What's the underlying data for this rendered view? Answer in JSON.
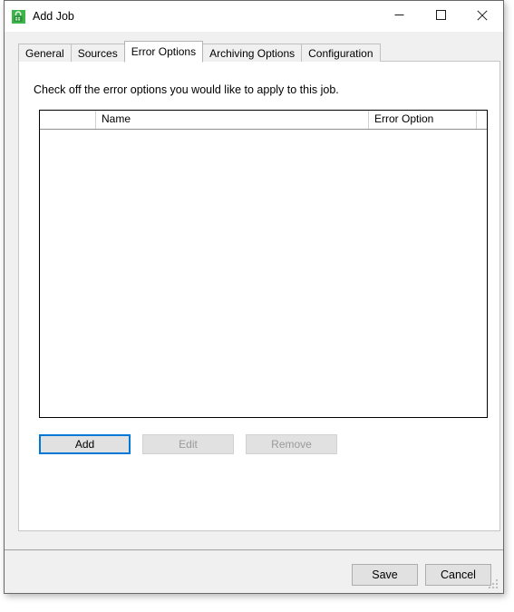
{
  "window": {
    "title": "Add Job",
    "icon": "green-lock-app-icon",
    "controls": {
      "minimize": "minimize-icon",
      "maximize": "maximize-icon",
      "close": "close-icon"
    }
  },
  "tabs": [
    {
      "label": "General",
      "selected": false
    },
    {
      "label": "Sources",
      "selected": false
    },
    {
      "label": "Error Options",
      "selected": true
    },
    {
      "label": "Archiving Options",
      "selected": false
    },
    {
      "label": "Configuration",
      "selected": false
    }
  ],
  "panel": {
    "instruction": "Check off the error options you would like to apply to this job."
  },
  "grid": {
    "columns": [
      {
        "key": "check",
        "label": ""
      },
      {
        "key": "name",
        "label": "Name"
      },
      {
        "key": "error",
        "label": "Error Option"
      },
      {
        "key": "tail",
        "label": ""
      }
    ],
    "rows": []
  },
  "list_buttons": {
    "add": {
      "label": "Add",
      "enabled": true,
      "focused": true
    },
    "edit": {
      "label": "Edit",
      "enabled": false,
      "focused": false
    },
    "remove": {
      "label": "Remove",
      "enabled": false,
      "focused": false
    }
  },
  "footer": {
    "save": "Save",
    "cancel": "Cancel",
    "grip": "resize-grip"
  },
  "colors": {
    "accent_focus": "#0078d7",
    "window_bg": "#f0f0f0",
    "panel_bg": "#ffffff",
    "button_face": "#e1e1e1",
    "disabled_text": "#9a9a9a",
    "app_icon_green": "#3cb54a"
  }
}
